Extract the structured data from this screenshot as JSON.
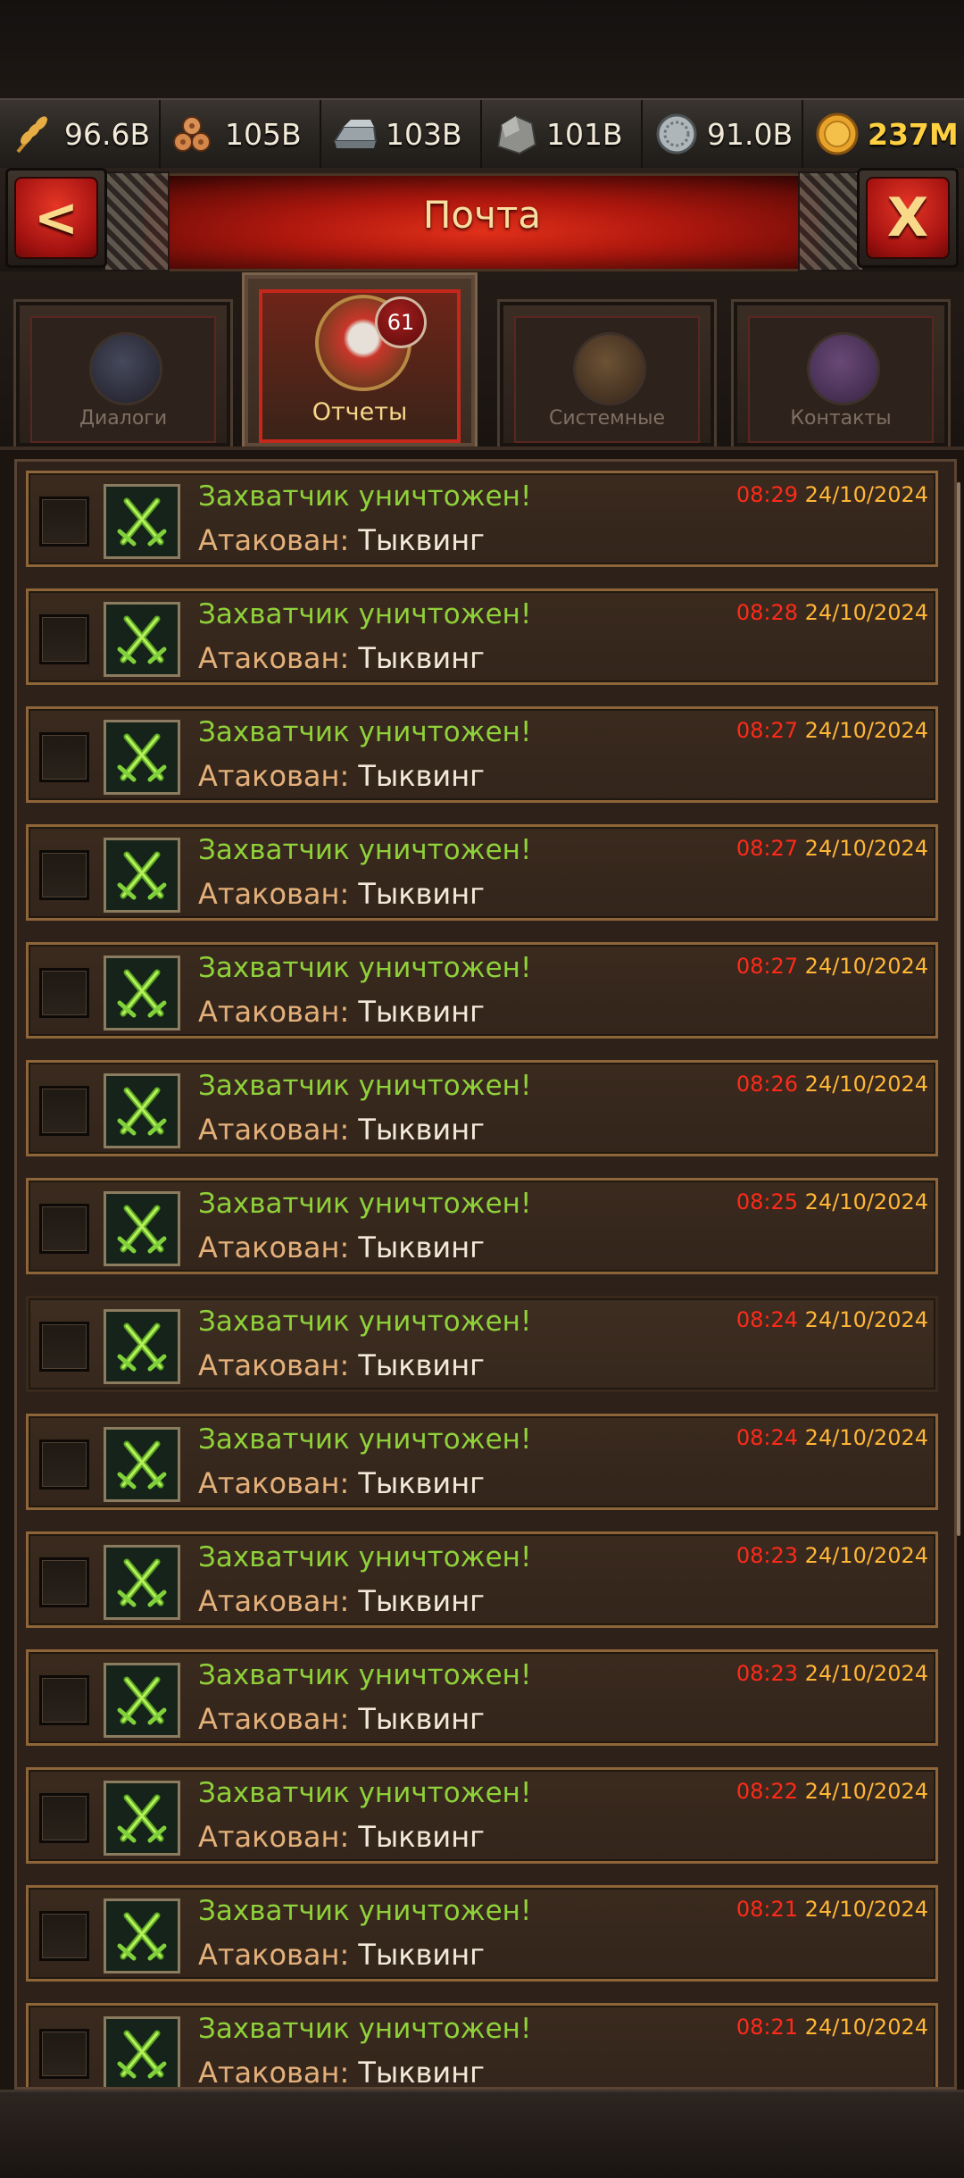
{
  "resources": [
    {
      "icon": "wheat-icon",
      "value": "96.6B"
    },
    {
      "icon": "wood-logs-icon",
      "value": "105B"
    },
    {
      "icon": "iron-ingot-icon",
      "value": "103B"
    },
    {
      "icon": "stone-icon",
      "value": "101B"
    },
    {
      "icon": "silver-coin-icon",
      "value": "91.0B"
    },
    {
      "icon": "gold-coin-icon",
      "value": "237M"
    }
  ],
  "header": {
    "title": "Почта",
    "back_symbol": "<",
    "close_symbol": "X"
  },
  "tabs": [
    {
      "label": "Диалоги",
      "active": false
    },
    {
      "label": "Отчеты",
      "active": true,
      "badge": "61"
    },
    {
      "label": "Системные",
      "active": false
    },
    {
      "label": "Контакты",
      "active": false
    }
  ],
  "reports": [
    {
      "title": "Захватчик уничтожен!",
      "label": "Атакован:",
      "name": "Тыквинг",
      "time": "08:29",
      "date": "24/10/2024"
    },
    {
      "title": "Захватчик уничтожен!",
      "label": "Атакован:",
      "name": "Тыквинг",
      "time": "08:28",
      "date": "24/10/2024"
    },
    {
      "title": "Захватчик уничтожен!",
      "label": "Атакован:",
      "name": "Тыквинг",
      "time": "08:27",
      "date": "24/10/2024"
    },
    {
      "title": "Захватчик уничтожен!",
      "label": "Атакован:",
      "name": "Тыквинг",
      "time": "08:27",
      "date": "24/10/2024"
    },
    {
      "title": "Захватчик уничтожен!",
      "label": "Атакован:",
      "name": "Тыквинг",
      "time": "08:27",
      "date": "24/10/2024"
    },
    {
      "title": "Захватчик уничтожен!",
      "label": "Атакован:",
      "name": "Тыквинг",
      "time": "08:26",
      "date": "24/10/2024"
    },
    {
      "title": "Захватчик уничтожен!",
      "label": "Атакован:",
      "name": "Тыквинг",
      "time": "08:25",
      "date": "24/10/2024"
    },
    {
      "title": "Захватчик уничтожен!",
      "label": "Атакован:",
      "name": "Тыквинг",
      "time": "08:24",
      "date": "24/10/2024"
    },
    {
      "title": "Захватчик уничтожен!",
      "label": "Атакован:",
      "name": "Тыквинг",
      "time": "08:24",
      "date": "24/10/2024"
    },
    {
      "title": "Захватчик уничтожен!",
      "label": "Атакован:",
      "name": "Тыквинг",
      "time": "08:23",
      "date": "24/10/2024"
    },
    {
      "title": "Захватчик уничтожен!",
      "label": "Атакован:",
      "name": "Тыквинг",
      "time": "08:23",
      "date": "24/10/2024"
    },
    {
      "title": "Захватчик уничтожен!",
      "label": "Атакован:",
      "name": "Тыквинг",
      "time": "08:22",
      "date": "24/10/2024"
    },
    {
      "title": "Захватчик уничтожен!",
      "label": "Атакован:",
      "name": "Тыквинг",
      "time": "08:21",
      "date": "24/10/2024"
    },
    {
      "title": "Захватчик уничтожен!",
      "label": "Атакован:",
      "name": "Тыквинг",
      "time": "08:21",
      "date": "24/10/2024"
    }
  ],
  "colors": {
    "report_title": "#8fd13a",
    "time": "#ff2a1a",
    "date": "#ffb637",
    "label": "#e4b07a",
    "header_banner": "#b0180e"
  }
}
